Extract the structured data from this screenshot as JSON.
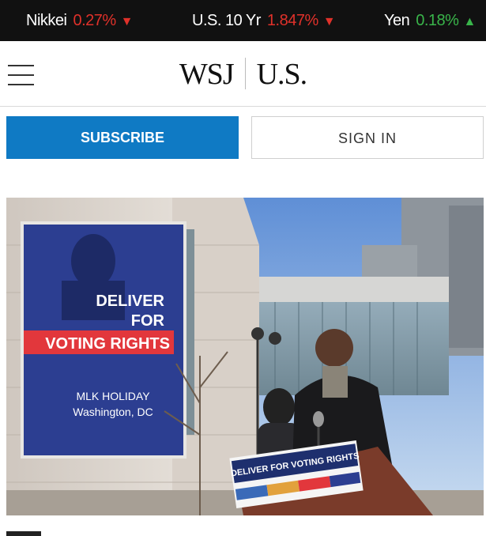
{
  "ticker": [
    {
      "name": "Nikkei",
      "value": "0.27%",
      "direction": "down"
    },
    {
      "name": "U.S. 10 Yr",
      "value": "1.847%",
      "direction": "down"
    },
    {
      "name": "Yen",
      "value": "0.18%",
      "direction": "up"
    }
  ],
  "header": {
    "brand": "WSJ",
    "edition": "U.S."
  },
  "auth": {
    "subscribe_label": "SUBSCRIBE",
    "signin_label": "SIGN IN"
  },
  "hero": {
    "banner_line1": "DELIVER",
    "banner_line2": "FOR",
    "banner_line3": "VOTING RIGHTS",
    "banner_event": "MLK HOLIDAY",
    "banner_place": "Washington, DC",
    "podium_sign": "DELIVER FOR VOTING RIGHTS"
  },
  "colors": {
    "ticker_bg": "#111111",
    "down": "#e0312a",
    "up": "#39b54a",
    "subscribe_bg": "#0f7ac4",
    "banner_blue": "#2c3e91",
    "banner_red": "#e2373c"
  },
  "icons": {
    "menu": "hamburger-menu-icon",
    "down": "triangle-down-icon",
    "up": "triangle-up-icon"
  }
}
